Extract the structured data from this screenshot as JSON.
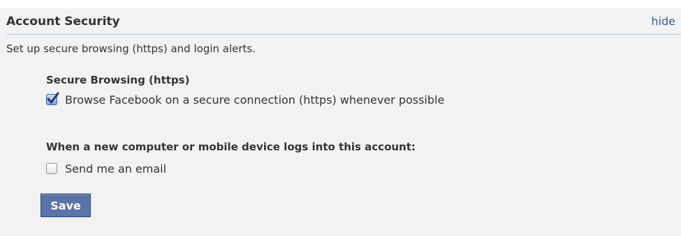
{
  "header": {
    "title": "Account Security",
    "hide_link": "hide"
  },
  "description": "Set up secure browsing (https) and login alerts.",
  "secure_browsing": {
    "title": "Secure Browsing (https)",
    "option_label": "Browse Facebook on a secure connection (https) whenever possible",
    "checked": true
  },
  "login_alerts": {
    "title": "When a new computer or mobile device logs into this account:",
    "option_label": "Send me an email",
    "checked": false
  },
  "save_button": {
    "label": "Save"
  },
  "colors": {
    "link": "#3b5998",
    "panel_background": "#f2f2f2",
    "button_background": "#5b74a8",
    "divider": "#c4cde0"
  }
}
